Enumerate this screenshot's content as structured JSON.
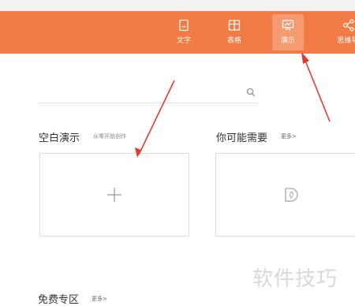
{
  "toolbar": {
    "items": [
      {
        "label": "文字",
        "icon": "document-icon"
      },
      {
        "label": "表格",
        "icon": "table-icon"
      },
      {
        "label": "演示",
        "icon": "presentation-icon",
        "active": true
      },
      {
        "label": "思维导",
        "icon": "mindmap-icon"
      }
    ],
    "color": "#f27a45"
  },
  "search": {
    "placeholder": ""
  },
  "blank_section": {
    "title": "空白演示",
    "subtitle": "从零开始创作"
  },
  "recommend_section": {
    "title": "你可能需要",
    "more": "更多>"
  },
  "free_section": {
    "title": "免费专区",
    "more": "更多>"
  },
  "watermark": "软件技巧"
}
